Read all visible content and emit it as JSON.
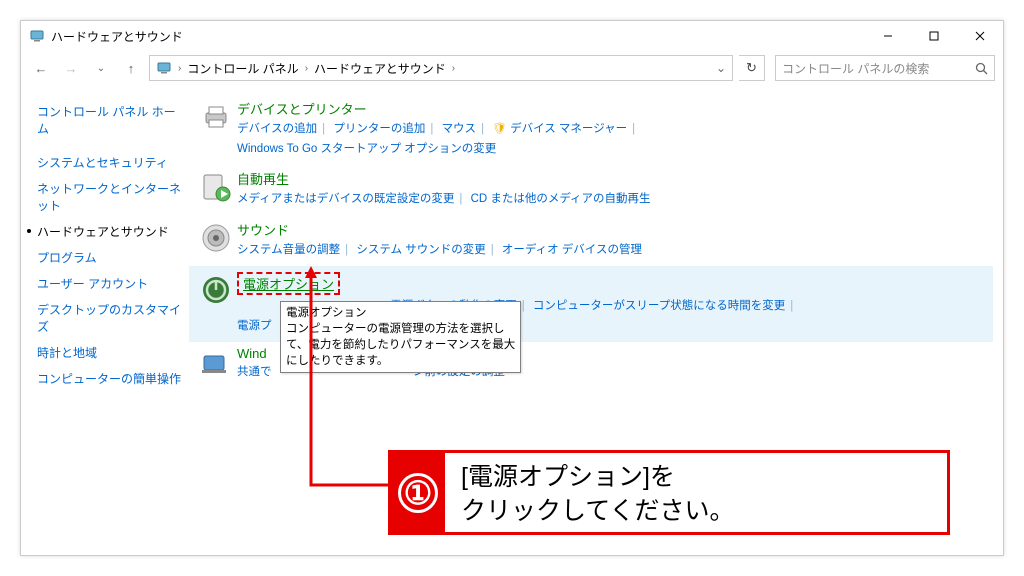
{
  "window": {
    "title": "ハードウェアとサウンド",
    "minimize": "–",
    "maximize": "□",
    "close": "×"
  },
  "breadcrumb": {
    "root": "コントロール パネル",
    "current": "ハードウェアとサウンド",
    "dropdown": "⌄",
    "refresh": "↻"
  },
  "search": {
    "placeholder": "コントロール パネルの検索",
    "icon": "🔍"
  },
  "sidebar": {
    "home": "コントロール パネル ホーム",
    "items": [
      "システムとセキュリティ",
      "ネットワークとインターネット",
      "ハードウェアとサウンド",
      "プログラム",
      "ユーザー アカウント",
      "デスクトップのカスタマイズ",
      "時計と地域",
      "コンピューターの簡単操作"
    ],
    "active_index": 2
  },
  "sections": {
    "devices": {
      "title": "デバイスとプリンター",
      "links": [
        "デバイスの追加",
        "プリンターの追加",
        "マウス"
      ],
      "shield_link": "デバイス マネージャー",
      "line2": "Windows To Go スタートアップ オプションの変更"
    },
    "autoplay": {
      "title": "自動再生",
      "links": [
        "メディアまたはデバイスの既定設定の変更",
        "CD または他のメディアの自動再生"
      ]
    },
    "sound": {
      "title": "サウンド",
      "links": [
        "システム音量の調整",
        "システム サウンドの変更",
        "オーディオ デバイスの管理"
      ]
    },
    "power": {
      "title": "電源オプション",
      "links_top": [],
      "links_mid": [
        "電源ボタンの動作の変更",
        "コンピューターがスリープ状態になる時間を変更"
      ],
      "line3_prefix": "電源プ"
    },
    "mobility": {
      "title": "Wind",
      "line": "共通で",
      "suffix": "ン前の設定の調整"
    }
  },
  "tooltip": {
    "title": "電源オプション",
    "body": "コンピューターの電源管理の方法を選択し\nて、電力を節約したりパフォーマンスを最大\nにしたりできます。"
  },
  "callout": {
    "number": "①",
    "text": "[電源オプション]を\nクリックしてください。"
  }
}
